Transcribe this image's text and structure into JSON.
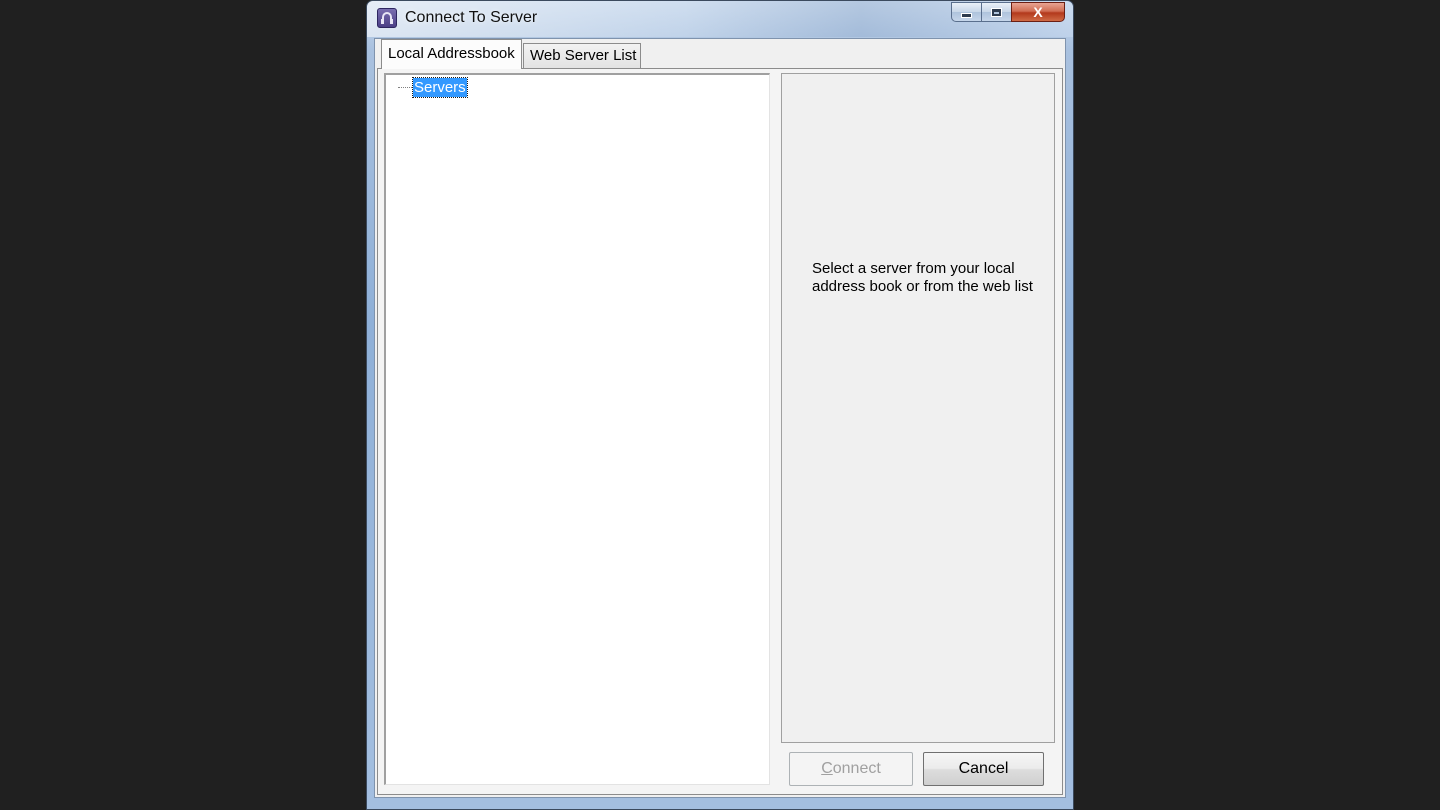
{
  "window": {
    "title": "Connect To Server",
    "icon": "app-icon"
  },
  "caption": {
    "minimize_icon": "minimize-icon",
    "maximize_icon": "maximize-icon",
    "close_glyph": "X"
  },
  "tabs": [
    {
      "label": "Local Addressbook",
      "active": true
    },
    {
      "label": "Web Server List",
      "active": false
    }
  ],
  "tree": {
    "root_label": "Servers",
    "selected": true
  },
  "info": {
    "message": "Select a server from your local\naddress book or from the web list"
  },
  "buttons": {
    "connect_mnemonic": "C",
    "connect_rest": "onnect",
    "connect_enabled": false,
    "cancel": "Cancel"
  },
  "colors": {
    "selection": "#3399ff",
    "close_button": "#c8452a",
    "disabled_text": "#a0a0a0"
  }
}
